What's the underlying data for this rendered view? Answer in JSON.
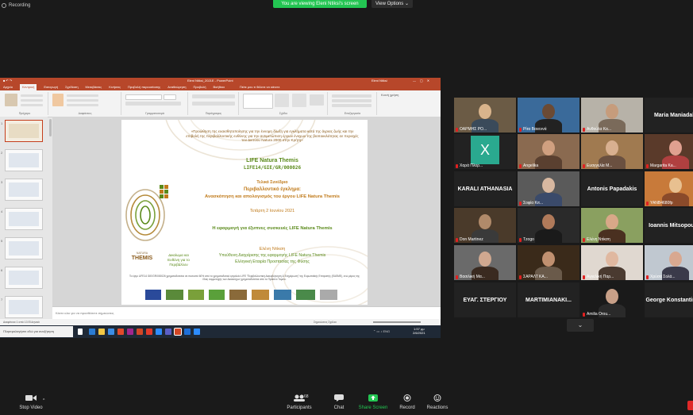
{
  "top": {
    "recording": "Recording",
    "viewing_banner": "You are viewing Eleni Ntiksi's screen",
    "view_options": "View Options ⌄"
  },
  "ppt": {
    "window_title": "Eleni Ntiksi_2021E - PowerPoint",
    "user": "Eleni Ntiksi",
    "tabs": [
      "Αρχείο",
      "Κεντρική",
      "Εισαγωγή",
      "Σχεδίαση",
      "Μεταβάσεις",
      "Κινήσεις",
      "Προβολή παρουσίασης",
      "Αναθεώρηση",
      "Προβολή",
      "Βοήθεια"
    ],
    "search_placeholder": "Πείτε μου τι θέλετε να κάνετε",
    "share": "Κοινή χρήση",
    "ribbon_groups": [
      "Πρόχειρο",
      "Διαφάνειες",
      "Γραμματοσειρά",
      "Παράγραφος",
      "Σχέδιο",
      "Επεξεργασία"
    ],
    "notes": "Κάντε κλικ για να προσθέσετε σημειώσεις",
    "status_left": "Διαφάνεια 1 από 13  Ελληνικά",
    "status_right": "Σημειώσεις  Σχόλια",
    "taskbar_search": "Πληκτρολογήστε εδώ για αναζήτηση",
    "taskbar_time": "1:57 μμ",
    "taskbar_date": "2/6/2021",
    "thumb_numbers": [
      "1",
      "2",
      "3",
      "4",
      "5",
      "6",
      "7"
    ]
  },
  "slide": {
    "intro": "«Προώθηση της ευαισθητοποίησης για την έννομη δίωξη για εγκλήματα κατά της άγριας ζωής και την επιβολή της περιβαλλοντικής ευθύνης για την αντιμετώπιση έργων ένοχων της βιοποικιλότητας σε περιοχές του Δικτύου Natura 2000 στην Κρήτη»",
    "project": "LIFE Natura Themis",
    "code": "LIFE14/GIE/GR/000026",
    "event": "Τελικό Συνέδριο",
    "subtitle": "Περιβαλλοντικό έγκλημα:",
    "subtitle2": "Ανασκόπηση και απολογισμός του έργου LIFE Natura Themis",
    "date": "Τετάρτη 2 Ιουνίου 2021",
    "topic": "Η εφαρμογή για έξυπνες συσκευές LIFE Natura Themis",
    "speaker": "Ελένη Ντίκση",
    "role": "Υπεύθυνη Διαχείρισης της εφαρμογής LIFE Natura Themis",
    "org": "Ελληνική Εταιρία Προστασίας της Φύσης",
    "logo_word": "THEMIS",
    "logo_small": "NATURA",
    "slogan": "Δικαίωμα και Ευθύνη για το Περιβάλλον",
    "footer": "Το έργο LIFE14 GIE/GR/000026 χρηματοδοτείται σε ποσοστό 60% από το χρηματοδοτικό εργαλείο LIFE \"Περιβαλλοντική Διακυβέρνηση & Ενημέρωση\" της Ευρωπαϊκής Επιτροπής (EASME), ενώ μέρος της ίδιας συμμετοχής των Δικαιούχων χρηματοδοτείται από το Πράσινο Ταμείο."
  },
  "gallery": [
    {
      "name": "ΟΑΡΜΗΣ ΡΟ...",
      "type": "photo",
      "colors": [
        "#6b5b45",
        "#d9b48c",
        "#3a4a5a"
      ]
    },
    {
      "name": "Ρίτα Βανεννά",
      "type": "photo",
      "colors": [
        "#3a6a9a",
        "#6b4a34",
        "#222"
      ]
    },
    {
      "name": "Ανθούλα Κα...",
      "type": "photo",
      "colors": [
        "#b7b2a8",
        "#c69c7c",
        "#7a6a5a"
      ]
    },
    {
      "name": "Maria Maniadaki",
      "type": "name"
    },
    {
      "name": "Χαρά Πλορ...",
      "type": "letter",
      "letter": "X"
    },
    {
      "name": "Angelika",
      "type": "photo",
      "colors": [
        "#8a6a50",
        "#d0a080",
        "#5a4030"
      ]
    },
    {
      "name": "Ευαγγελία Μ...",
      "type": "photo",
      "colors": [
        "#a07a50",
        "#d8b090",
        "#6a5040"
      ]
    },
    {
      "name": "Margarita Ka...",
      "type": "photo",
      "colors": [
        "#5a3a2a",
        "#e0a090",
        "#b04040"
      ]
    },
    {
      "name": "KARALI ATHANASIA",
      "type": "name"
    },
    {
      "name": "Σοφία Κιτ...",
      "type": "photo",
      "colors": [
        "#5a5a5a",
        "#d8b8a0",
        "#3a4a6a"
      ]
    },
    {
      "name": "Antonis Papadakis",
      "type": "name"
    },
    {
      "name": "YANB4680fp",
      "type": "photo",
      "colors": [
        "#c87a3a",
        "#e8c090",
        "#8a4a2a"
      ]
    },
    {
      "name": "Don Martinez",
      "type": "photo",
      "colors": [
        "#4a3a2a",
        "#b08a6a",
        "#3a3a3a"
      ]
    },
    {
      "name": "Tzogo",
      "type": "photo",
      "colors": [
        "#2a2a2a",
        "#b07a5a",
        "#1a1a1a"
      ]
    },
    {
      "name": "Ελένη Ντίκση",
      "type": "photo",
      "active": true,
      "colors": [
        "#8aa060",
        "#d8a888",
        "#4a3020"
      ]
    },
    {
      "name": "Ioannis Mitsopoulos",
      "type": "name"
    },
    {
      "name": "Βασιλική Μα...",
      "type": "photo",
      "colors": [
        "#6a6a6a",
        "#d0a890",
        "#3a2a20"
      ]
    },
    {
      "name": "ΣΑΡΑΛΤ ΚΑ...",
      "type": "photo",
      "colors": [
        "#3a2a1a",
        "#c09070",
        "#6a5a4a"
      ]
    },
    {
      "name": "Αγγελική Παρ...",
      "type": "photo",
      "colors": [
        "#e0d8d0",
        "#e0b8a0",
        "#4a3a30"
      ]
    },
    {
      "name": "Χρύσα Σολά...",
      "type": "photo",
      "colors": [
        "#c0c8d0",
        "#d8a890",
        "#3a3a4a"
      ]
    },
    {
      "name": "ΕΥΑΓ. ΣΤΕΡΓΙΟΥ",
      "type": "name"
    },
    {
      "name": "MARTIMIANAKI...",
      "type": "name"
    },
    {
      "name": "Amilia Orou...",
      "type": "photo",
      "colors": [
        "#1a1a1a",
        "#c8a088",
        "#2a2a2a"
      ]
    },
    {
      "name": "George Konstantinidis",
      "type": "name"
    }
  ],
  "more": "⌄",
  "toolbar": {
    "stop_video": "Stop Video",
    "participants": "Participants",
    "participants_count": "68",
    "chat": "Chat",
    "share_screen": "Share Screen",
    "record": "Record",
    "reactions": "Reactions"
  },
  "colors": {
    "ppt_accent": "#b7472a",
    "zoom_green": "#23c552",
    "active_speaker": "#9ae32d",
    "muted": "#e02020",
    "title_green": "#5a8a1a",
    "subtitle_orange": "#c07a1a"
  }
}
